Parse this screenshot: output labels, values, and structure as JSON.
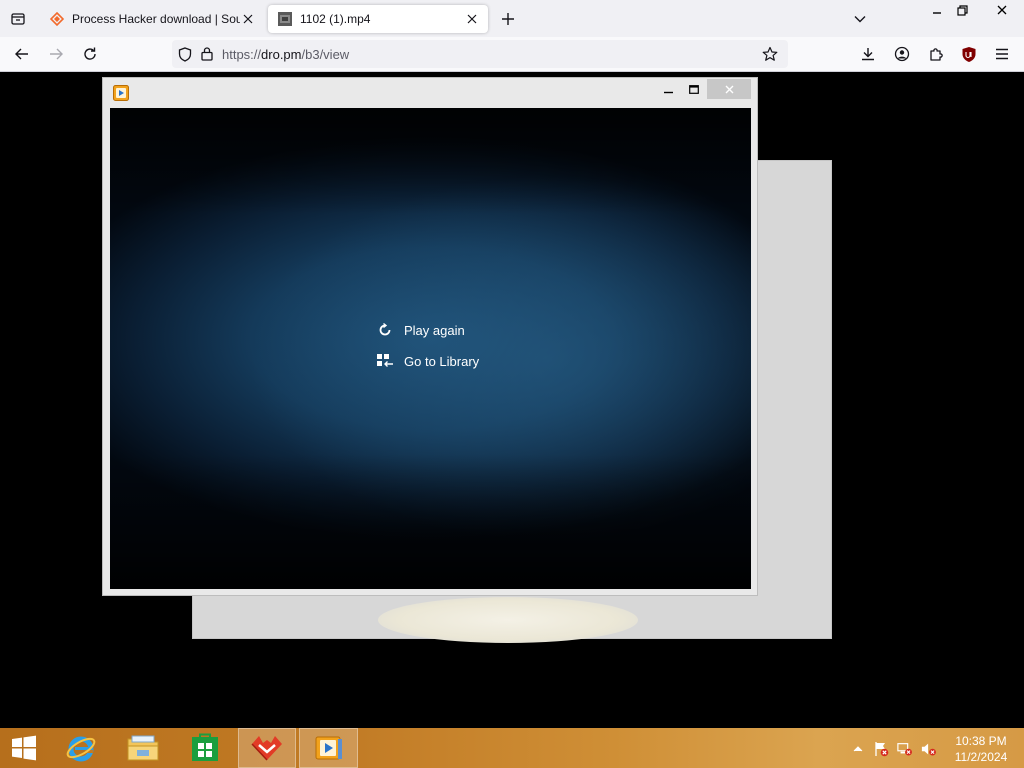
{
  "browser": {
    "tabs": [
      {
        "title": "Process Hacker download | Sou",
        "active": false
      },
      {
        "title": "1102 (1).mp4",
        "active": true
      }
    ],
    "url": {
      "scheme": "https://",
      "host": "dro.pm",
      "path": "/b3/view"
    }
  },
  "player": {
    "menu": [
      {
        "label": "Play again",
        "icon": "replay-icon"
      },
      {
        "label": "Go to Library",
        "icon": "library-icon"
      }
    ]
  },
  "taskbar": {
    "apps": [
      "start-button",
      "internet-explorer",
      "file-explorer",
      "store",
      "red-app",
      "media-player"
    ],
    "clock": {
      "time": "10:38 PM",
      "date": "11/2/2024"
    }
  },
  "colors": {
    "taskbar": "#c27c26",
    "browser_chrome": "#f0f0f4",
    "video_blue": "#1d4e74"
  }
}
